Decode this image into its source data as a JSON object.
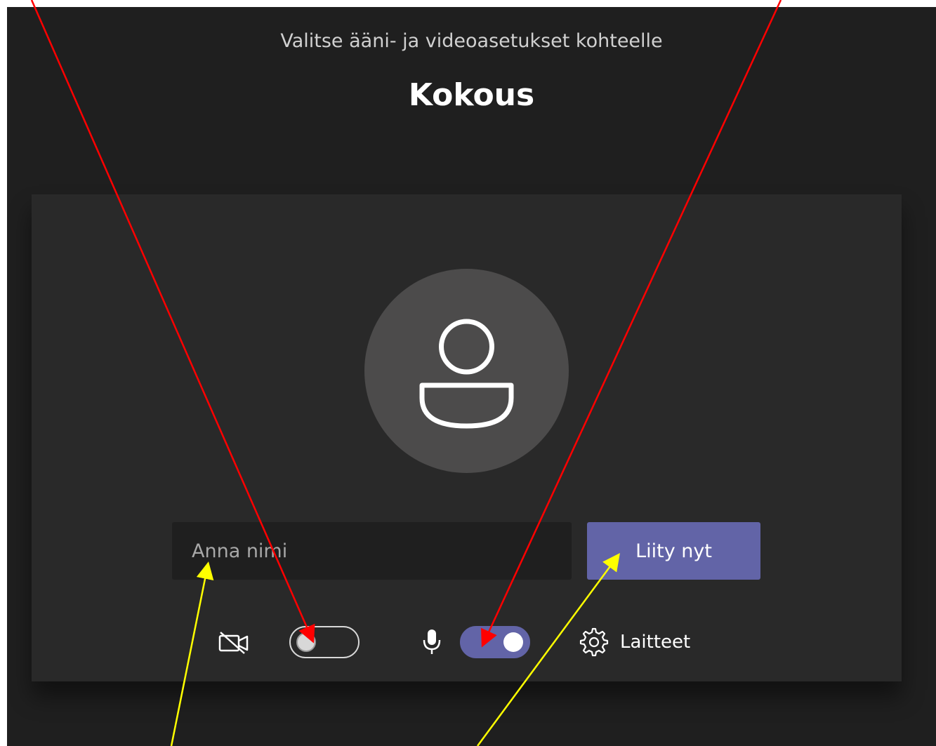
{
  "header": {
    "subtitle": "Valitse ääni- ja videoasetukset kohteelle",
    "meeting_title": "Kokous"
  },
  "join_form": {
    "name_placeholder": "Anna nimi",
    "name_value": "",
    "join_button_label": "Liity nyt"
  },
  "controls": {
    "camera_on": false,
    "microphone_on": true,
    "devices_label": "Laitteet"
  },
  "icons": {
    "avatar": "person-icon",
    "camera": "camera-off-icon",
    "microphone": "microphone-icon",
    "devices": "gear-icon"
  },
  "colors": {
    "accent": "#6264a7",
    "background": "#1f1f1f",
    "panel": "#292929",
    "avatar_circle": "#4c4b4b",
    "annotation_red": "#ff0000",
    "annotation_yellow": "#ffff00"
  }
}
